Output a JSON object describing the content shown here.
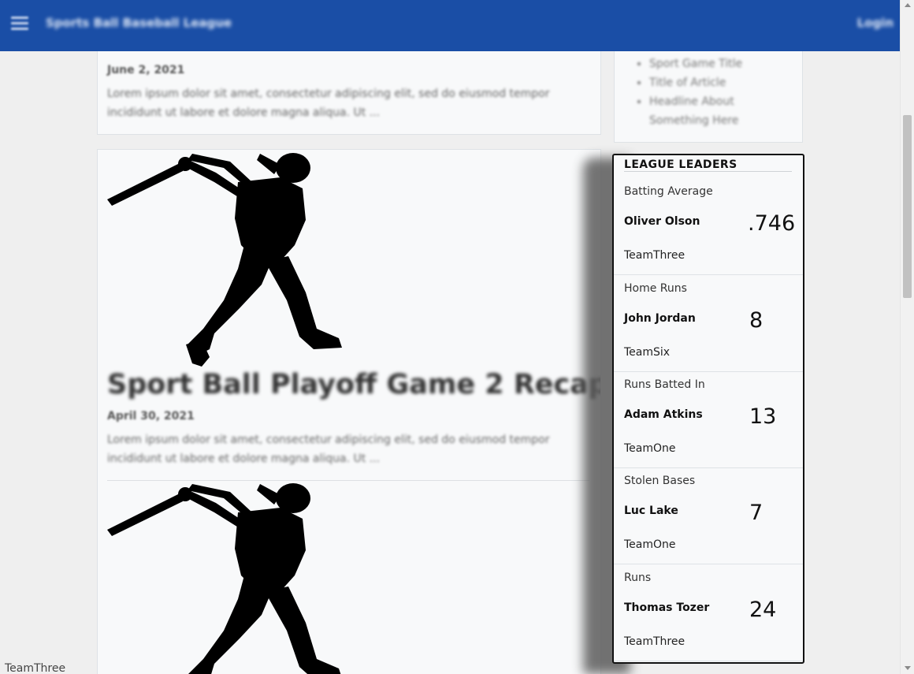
{
  "navbar": {
    "brand": "Sports Ball Baseball League",
    "login_label": "Login",
    "menu_icon": "hamburger-icon",
    "color": "#1a4ea6"
  },
  "articles": [
    {
      "date": "June 2, 2021",
      "excerpt": "Lorem ipsum dolor sit amet, consectetur adipiscing elit, sed do eiusmod tempor incididunt ut labore et dolore magna aliqua. Ut ..."
    },
    {
      "image": "batter-silhouette",
      "title": "Sport Ball Playoff Game 2 Recap",
      "date": "April 30, 2021",
      "excerpt": "Lorem ipsum dolor sit amet, consectetur adipiscing elit, sed do eiusmod tempor incididunt ut labore et dolore magna aliqua. Ut ..."
    },
    {
      "image": "batter-silhouette"
    }
  ],
  "sidebar": {
    "links": [
      "Sport Game Title",
      "Title of Article",
      "Headline About Something Here"
    ]
  },
  "leaders": {
    "title": "LEAGUE LEADERS",
    "stats": [
      {
        "category": "Batting Average",
        "player": "Oliver Olson",
        "team": "TeamThree",
        "value": ".746"
      },
      {
        "category": "Home Runs",
        "player": "John Jordan",
        "team": "TeamSix",
        "value": "8"
      },
      {
        "category": "Runs Batted In",
        "player": "Adam Atkins",
        "team": "TeamOne",
        "value": "13"
      },
      {
        "category": "Stolen Bases",
        "player": "Luc Lake",
        "team": "TeamOne",
        "value": "7"
      },
      {
        "category": "Runs",
        "player": "Thomas Tozer",
        "team": "TeamThree",
        "value": "24"
      }
    ]
  },
  "footer_text": "TeamThree"
}
